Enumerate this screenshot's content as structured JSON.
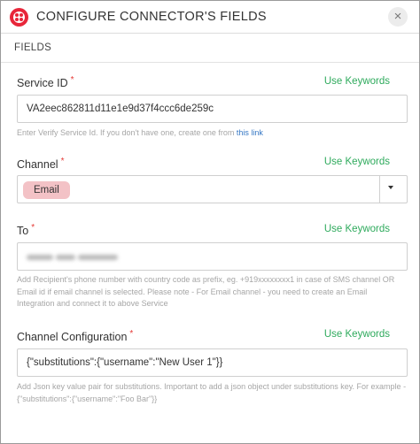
{
  "dialog": {
    "title": "CONFIGURE CONNECTOR'S FIELDS",
    "close_label": "×",
    "logo_icon": "twilio-logo-icon",
    "brand_color": "#e8263a"
  },
  "section": {
    "title": "FIELDS"
  },
  "keywords_label": "Use Keywords",
  "keywords_color": "#2eaa5c",
  "fields": {
    "service_id": {
      "label": "Service ID",
      "required_mark": "*",
      "value": "VA2eec862811d11e1e9d37f4ccc6de259c",
      "help": "Enter Verify Service Id. If you don't have one, create one from",
      "help_link": "this link"
    },
    "channel": {
      "label": "Channel",
      "required_mark": "*",
      "selected": "Email",
      "dropdown_icon": "caret-down-icon"
    },
    "to": {
      "label": "To",
      "required_mark": "*",
      "value_blurred": true,
      "help": "Add Recipient's phone number with country code as prefix, eg. +919xxxxxxxx1 in case of SMS channel OR Email id if email channel is selected. Please note - For Email channel - you need to create an Email Integration and connect it to above Service"
    },
    "channel_configuration": {
      "label": "Channel Configuration",
      "required_mark": "*",
      "value": "{\"substitutions\":{\"username\":\"New User 1\"}}",
      "help": "Add Json key value pair for substitutions. Important to add a json object under substitutions key. For example - {\"substitutions\":{\"username\":\"Foo Bar\"}}"
    }
  }
}
